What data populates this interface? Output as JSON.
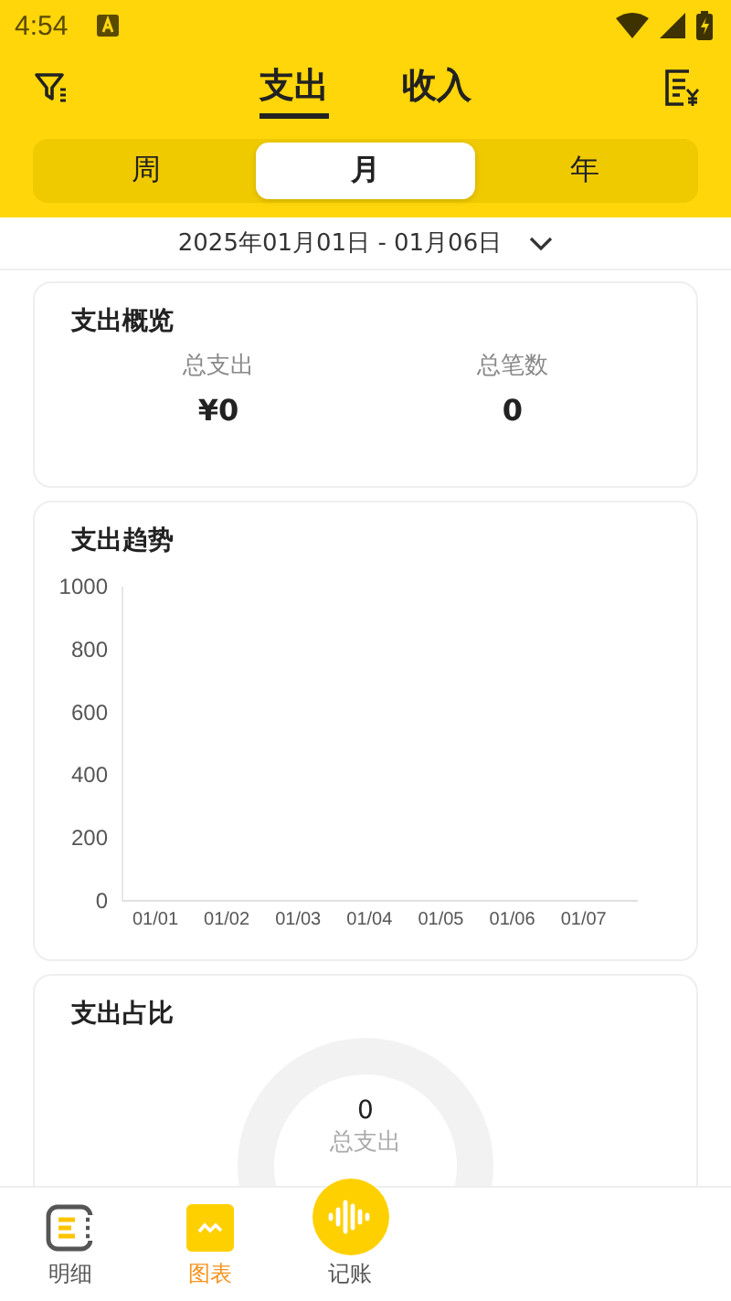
{
  "status_bar": {
    "time": "4:54"
  },
  "header": {
    "tabs": [
      {
        "label": "支出",
        "selected": true
      },
      {
        "label": "收入",
        "selected": false
      }
    ]
  },
  "period_tabs": [
    {
      "label": "周",
      "selected": false
    },
    {
      "label": "月",
      "selected": true
    },
    {
      "label": "年",
      "selected": false
    }
  ],
  "date_range": "2025年01月01日 - 01月06日",
  "overview": {
    "title": "支出概览",
    "stats": [
      {
        "label": "总支出",
        "value": "¥0"
      },
      {
        "label": "总笔数",
        "value": "0"
      }
    ]
  },
  "trend": {
    "title": "支出趋势",
    "chart_data": {
      "type": "line",
      "categories": [
        "01/01",
        "01/02",
        "01/03",
        "01/04",
        "01/05",
        "01/06",
        "01/07"
      ],
      "ylim": [
        0,
        1000
      ],
      "yticks": [
        0,
        200,
        400,
        600,
        800,
        1000
      ]
    }
  },
  "share": {
    "title": "支出占比",
    "center_value": "0",
    "center_label": "总支出"
  },
  "bottom_nav": [
    {
      "label": "明细",
      "kind": "list",
      "selected": false
    },
    {
      "label": "图表",
      "kind": "chart",
      "selected": true
    },
    {
      "label": "记账",
      "kind": "action",
      "selected": false
    }
  ]
}
